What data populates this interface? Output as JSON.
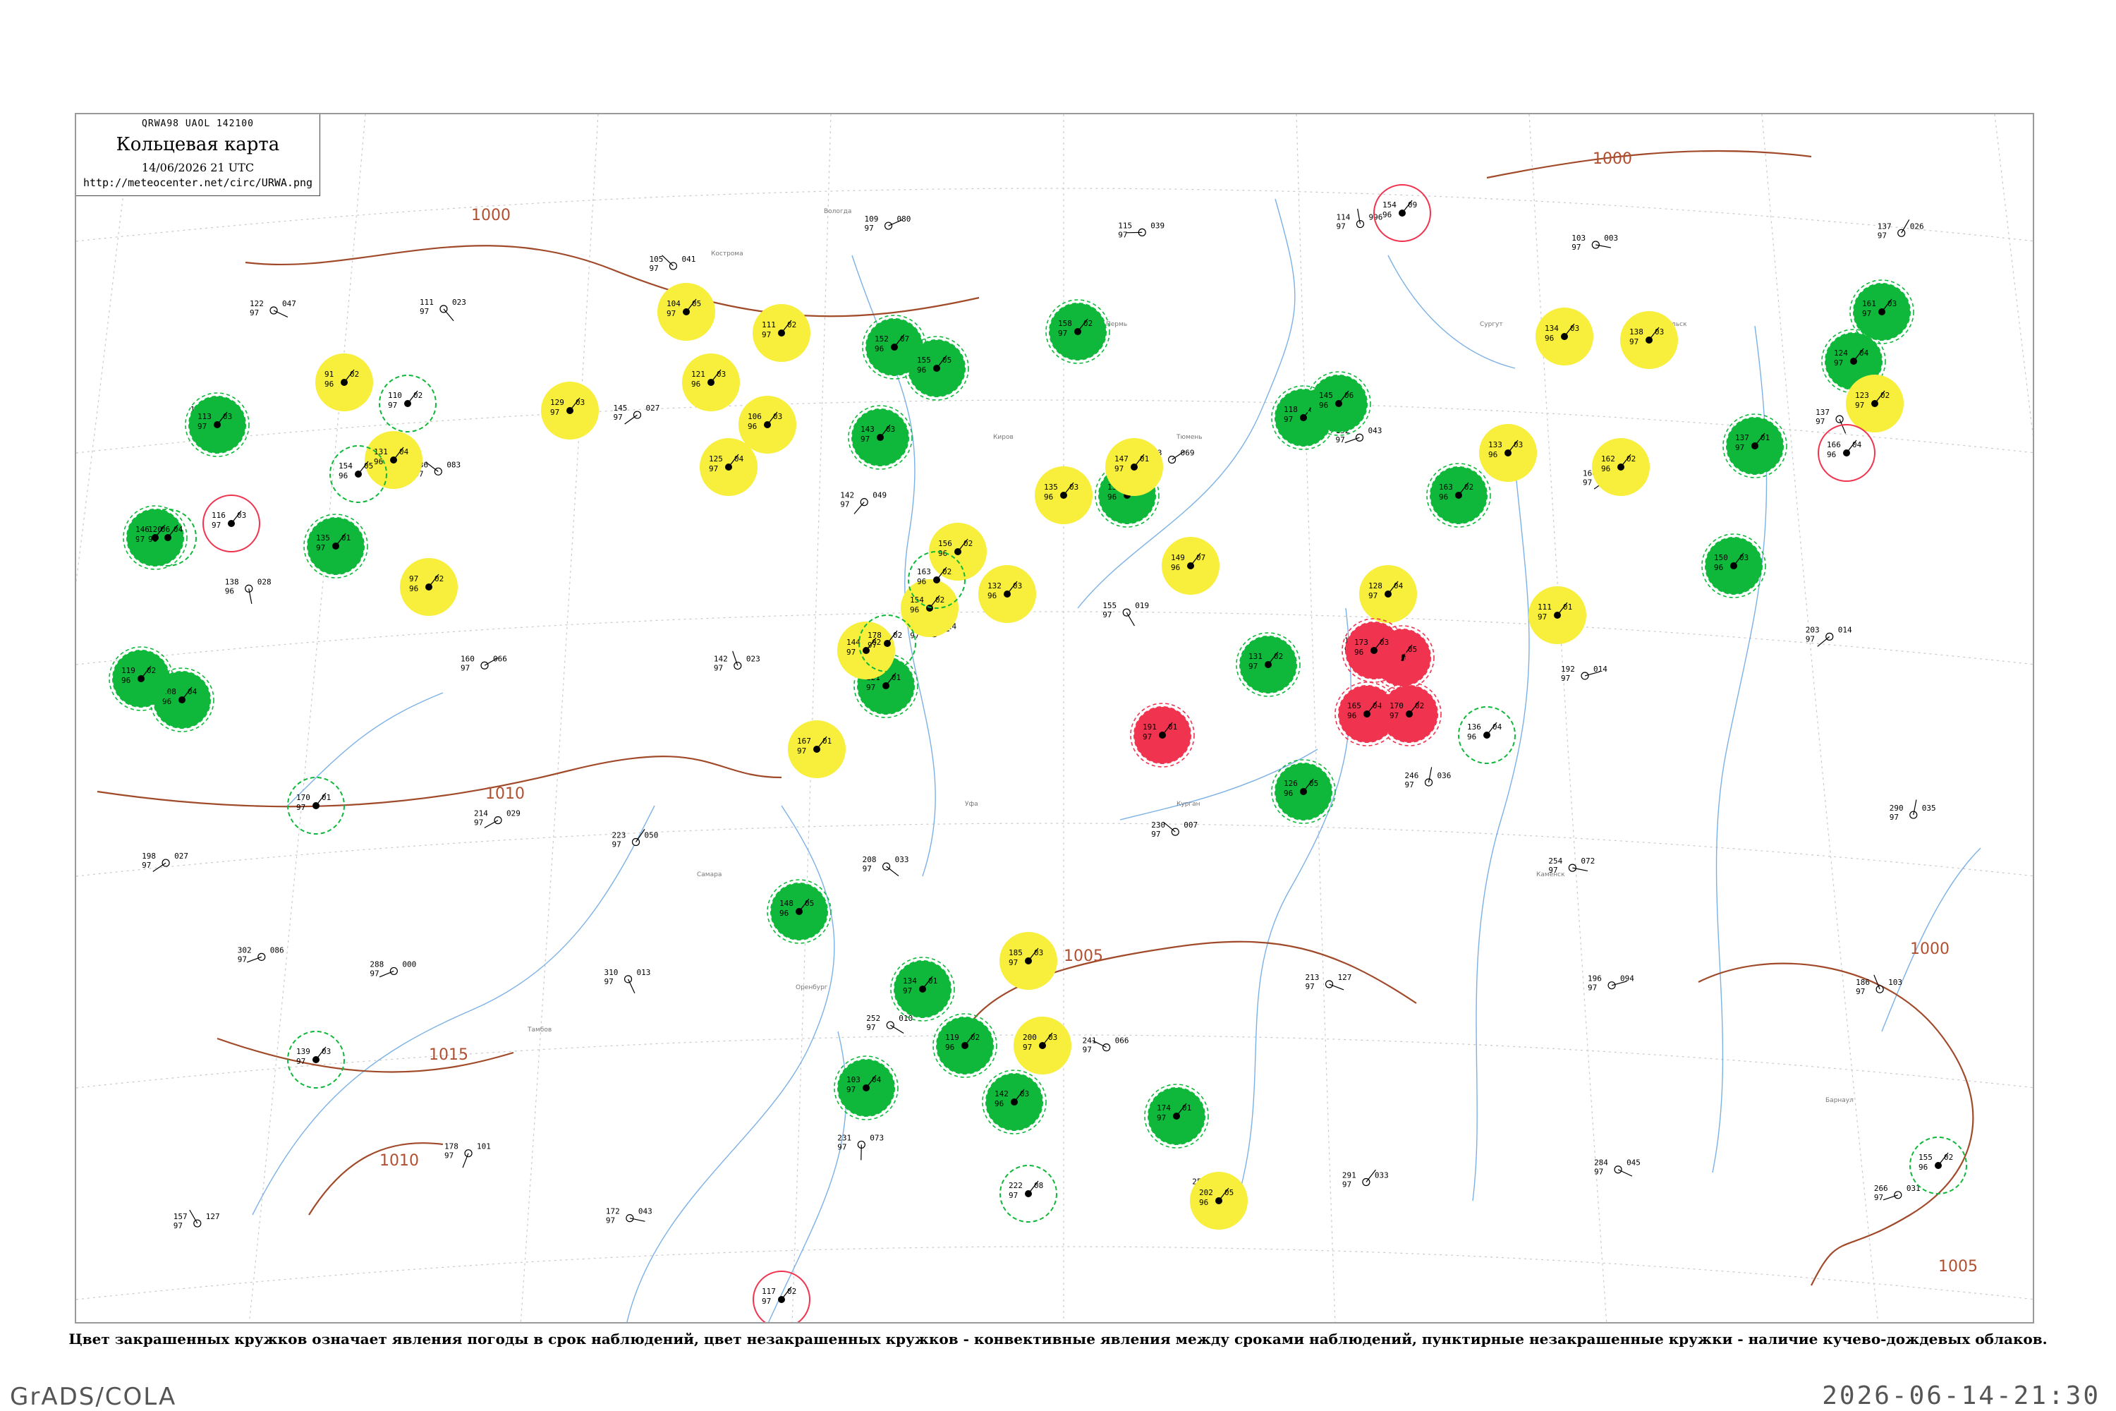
{
  "header": {
    "code_line": "QRWA98 UAOL 142100",
    "title": "Кольцевая карта",
    "datetime": "14/06/2026 21 UTC",
    "url": "http://meteocenter.net/circ/URWA.png"
  },
  "caption": "Цвет закрашенных кружков означает явления погоды в срок наблюдений, цвет незакрашенных кружков - конвективные явления между сроками наблюдений, пунктирные незакрашенные кружки - наличие кучево-дождевых облаков.",
  "footer": {
    "left": "GrADS/COLA",
    "right": "2026-06-14-21:30"
  },
  "colors": {
    "green": "#0fb83a",
    "yellow": "#f7ef3c",
    "pink": "#f0344f",
    "isobar": "#a04a2a",
    "river": "#5a9ee0"
  },
  "isobars": [
    {
      "label": "1000"
    },
    {
      "label": "1005"
    },
    {
      "label": "1010"
    },
    {
      "label": "1015"
    },
    {
      "label": "1010"
    },
    {
      "label": "1005"
    },
    {
      "label": "1000"
    },
    {
      "label": "1000"
    }
  ],
  "stations": [
    {
      "t": "113",
      "d": "97",
      "p": "03",
      "c": "green"
    },
    {
      "t": "146",
      "d": "97",
      "p": "06",
      "c": "green"
    },
    {
      "t": "108",
      "d": "96",
      "p": "04",
      "c": "green"
    },
    {
      "t": "119",
      "d": "96",
      "p": "02",
      "c": "green"
    },
    {
      "t": "135",
      "d": "97",
      "p": "01",
      "c": "green"
    },
    {
      "t": "152",
      "d": "96",
      "p": "07",
      "c": "green"
    },
    {
      "t": "143",
      "d": "97",
      "p": "03",
      "c": "green"
    },
    {
      "t": "155",
      "d": "96",
      "p": "05",
      "c": "green"
    },
    {
      "t": "121",
      "d": "97",
      "p": "01",
      "c": "green"
    },
    {
      "t": "158",
      "d": "97",
      "p": "02",
      "c": "green"
    },
    {
      "t": "139",
      "d": "96",
      "p": "04",
      "c": "green"
    },
    {
      "t": "118",
      "d": "97",
      "p": "03",
      "c": "green"
    },
    {
      "t": "126",
      "d": "96",
      "p": "05",
      "c": "green"
    },
    {
      "t": "131",
      "d": "97",
      "p": "02",
      "c": "green"
    },
    {
      "t": "145",
      "d": "96",
      "p": "06",
      "c": "green"
    },
    {
      "t": "137",
      "d": "97",
      "p": "01",
      "c": "green"
    },
    {
      "t": "150",
      "d": "96",
      "p": "03",
      "c": "green"
    },
    {
      "t": "124",
      "d": "97",
      "p": "04",
      "c": "green"
    },
    {
      "t": "163",
      "d": "96",
      "p": "02",
      "c": "green"
    },
    {
      "t": "161",
      "d": "97",
      "p": "03",
      "c": "green"
    },
    {
      "t": "148",
      "d": "96",
      "p": "05",
      "c": "green"
    },
    {
      "t": "134",
      "d": "97",
      "p": "01",
      "c": "green"
    },
    {
      "t": "119",
      "d": "96",
      "p": "02",
      "c": "green"
    },
    {
      "t": "103",
      "d": "97",
      "p": "04",
      "c": "green"
    },
    {
      "t": "142",
      "d": "96",
      "p": "03",
      "c": "green"
    },
    {
      "t": "174",
      "d": "97",
      "p": "01",
      "c": "green"
    },
    {
      "t": "91",
      "d": "96",
      "p": "02",
      "c": "yellow"
    },
    {
      "t": "131",
      "d": "96",
      "p": "04",
      "c": "yellow"
    },
    {
      "t": "129",
      "d": "97",
      "p": "03",
      "c": "yellow"
    },
    {
      "t": "97",
      "d": "96",
      "p": "02",
      "c": "yellow"
    },
    {
      "t": "104",
      "d": "97",
      "p": "05",
      "c": "yellow"
    },
    {
      "t": "121",
      "d": "96",
      "p": "03",
      "c": "yellow"
    },
    {
      "t": "125",
      "d": "97",
      "p": "04",
      "c": "yellow"
    },
    {
      "t": "106",
      "d": "96",
      "p": "03",
      "c": "yellow"
    },
    {
      "t": "111",
      "d": "97",
      "p": "02",
      "c": "yellow"
    },
    {
      "t": "144",
      "d": "97",
      "p": "02",
      "c": "yellow"
    },
    {
      "t": "154",
      "d": "96",
      "p": "02",
      "c": "yellow"
    },
    {
      "t": "156",
      "d": "96",
      "p": "02",
      "c": "yellow"
    },
    {
      "t": "147",
      "d": "97",
      "p": "01",
      "c": "yellow"
    },
    {
      "t": "135",
      "d": "96",
      "p": "03",
      "c": "yellow"
    },
    {
      "t": "149",
      "d": "96",
      "p": "07",
      "c": "yellow"
    },
    {
      "t": "128",
      "d": "97",
      "p": "04",
      "c": "yellow"
    },
    {
      "t": "133",
      "d": "96",
      "p": "03",
      "c": "yellow"
    },
    {
      "t": "134",
      "d": "96",
      "p": "03",
      "c": "yellow"
    },
    {
      "t": "138",
      "d": "97",
      "p": "03",
      "c": "yellow"
    },
    {
      "t": "162",
      "d": "96",
      "p": "02",
      "c": "yellow"
    },
    {
      "t": "123",
      "d": "97",
      "p": "02",
      "c": "yellow"
    },
    {
      "t": "202",
      "d": "96",
      "p": "05",
      "c": "yellow"
    },
    {
      "t": "200",
      "d": "97",
      "p": "03",
      "c": "yellow"
    },
    {
      "t": "185",
      "d": "97",
      "p": "03",
      "c": "yellow"
    },
    {
      "t": "111",
      "d": "97",
      "p": "01",
      "c": "yellow"
    },
    {
      "t": "167",
      "d": "97",
      "p": "01",
      "c": "yellow"
    },
    {
      "t": "132",
      "d": "96",
      "p": "03",
      "c": "yellow"
    },
    {
      "t": "174",
      "d": "97",
      "p": "05",
      "c": "pink"
    },
    {
      "t": "173",
      "d": "96",
      "p": "03",
      "c": "pink"
    },
    {
      "t": "191",
      "d": "97",
      "p": "01",
      "c": "pink"
    },
    {
      "t": "165",
      "d": "96",
      "p": "04",
      "c": "pink"
    },
    {
      "t": "170",
      "d": "97",
      "p": "02",
      "c": "pink"
    },
    {
      "t": "110",
      "d": "97",
      "p": "02",
      "c": "ring-green"
    },
    {
      "t": "154",
      "d": "96",
      "p": "05",
      "c": "ring-green"
    },
    {
      "t": "170",
      "d": "97",
      "p": "01",
      "c": "ring-green"
    },
    {
      "t": "120",
      "d": "96",
      "p": "04",
      "c": "ring-green"
    },
    {
      "t": "139",
      "d": "97",
      "p": "03",
      "c": "ring-green"
    },
    {
      "t": "163",
      "d": "96",
      "p": "02",
      "c": "ring-green"
    },
    {
      "t": "178",
      "d": "97",
      "p": "02",
      "c": "ring-green"
    },
    {
      "t": "136",
      "d": "96",
      "p": "04",
      "c": "ring-green"
    },
    {
      "t": "222",
      "d": "97",
      "p": "08",
      "c": "ring-green"
    },
    {
      "t": "155",
      "d": "96",
      "p": "02",
      "c": "ring-green"
    },
    {
      "t": "116",
      "d": "97",
      "p": "03",
      "c": "ring-pink"
    },
    {
      "t": "154",
      "d": "96",
      "p": "09",
      "c": "ring-pink"
    },
    {
      "t": "117",
      "d": "97",
      "p": "02",
      "c": "ring-pink"
    },
    {
      "t": "166",
      "d": "96",
      "p": "04",
      "c": "ring-pink"
    }
  ],
  "plain_stations": [
    {
      "t": "122",
      "d": "97",
      "p": "047"
    },
    {
      "t": "111",
      "d": "97",
      "p": "023"
    },
    {
      "t": "105",
      "d": "97",
      "p": "041"
    },
    {
      "t": "109",
      "d": "97",
      "p": "080"
    },
    {
      "t": "115",
      "d": "97",
      "p": "039"
    },
    {
      "t": "114",
      "d": "97",
      "p": "996"
    },
    {
      "t": "103",
      "d": "97",
      "p": "003"
    },
    {
      "t": "137",
      "d": "97",
      "p": "026"
    },
    {
      "t": "166",
      "d": "97",
      "p": "027"
    },
    {
      "t": "136",
      "d": "97",
      "p": "083"
    },
    {
      "t": "145",
      "d": "97",
      "p": "027"
    },
    {
      "t": "142",
      "d": "97",
      "p": "049"
    },
    {
      "t": "173",
      "d": "97",
      "p": "069"
    },
    {
      "t": "152",
      "d": "97",
      "p": "043"
    },
    {
      "t": "166",
      "d": "97",
      "p": "051"
    },
    {
      "t": "137",
      "d": "97",
      "p": "045"
    },
    {
      "t": "138",
      "d": "96",
      "p": "028"
    },
    {
      "t": "160",
      "d": "97",
      "p": "066"
    },
    {
      "t": "142",
      "d": "97",
      "p": "023"
    },
    {
      "t": "141",
      "d": "97",
      "p": "014"
    },
    {
      "t": "155",
      "d": "97",
      "p": "019"
    },
    {
      "t": "174",
      "d": "97",
      "p": "013"
    },
    {
      "t": "192",
      "d": "97",
      "p": "014"
    },
    {
      "t": "203",
      "d": "97",
      "p": "014"
    },
    {
      "t": "198",
      "d": "97",
      "p": "027"
    },
    {
      "t": "214",
      "d": "97",
      "p": "029"
    },
    {
      "t": "223",
      "d": "97",
      "p": "050"
    },
    {
      "t": "208",
      "d": "97",
      "p": "033"
    },
    {
      "t": "230",
      "d": "97",
      "p": "007"
    },
    {
      "t": "246",
      "d": "97",
      "p": "036"
    },
    {
      "t": "254",
      "d": "97",
      "p": "072"
    },
    {
      "t": "290",
      "d": "97",
      "p": "035"
    },
    {
      "t": "302",
      "d": "97",
      "p": "086"
    },
    {
      "t": "288",
      "d": "97",
      "p": "000"
    },
    {
      "t": "310",
      "d": "97",
      "p": "013"
    },
    {
      "t": "252",
      "d": "97",
      "p": "010"
    },
    {
      "t": "241",
      "d": "97",
      "p": "066"
    },
    {
      "t": "213",
      "d": "97",
      "p": "127"
    },
    {
      "t": "196",
      "d": "97",
      "p": "094"
    },
    {
      "t": "186",
      "d": "97",
      "p": "103"
    },
    {
      "t": "157",
      "d": "97",
      "p": "127"
    },
    {
      "t": "178",
      "d": "97",
      "p": "101"
    },
    {
      "t": "172",
      "d": "97",
      "p": "043"
    },
    {
      "t": "231",
      "d": "97",
      "p": "073"
    },
    {
      "t": "253",
      "d": "97",
      "p": "081"
    },
    {
      "t": "291",
      "d": "97",
      "p": "033"
    },
    {
      "t": "284",
      "d": "97",
      "p": "045"
    },
    {
      "t": "266",
      "d": "97",
      "p": "031"
    }
  ],
  "places": [
    {
      "name": "Вологда"
    },
    {
      "name": "Кострома"
    },
    {
      "name": "Киров"
    },
    {
      "name": "Пермь"
    },
    {
      "name": "Самара"
    },
    {
      "name": "Оренбург"
    },
    {
      "name": "Уфа"
    },
    {
      "name": "Сургут"
    },
    {
      "name": "Тюмень"
    },
    {
      "name": "Курган"
    },
    {
      "name": "Тобольск"
    },
    {
      "name": "Барнаул"
    },
    {
      "name": "Каменск"
    },
    {
      "name": "Ижевск"
    },
    {
      "name": "Тамбов"
    }
  ]
}
